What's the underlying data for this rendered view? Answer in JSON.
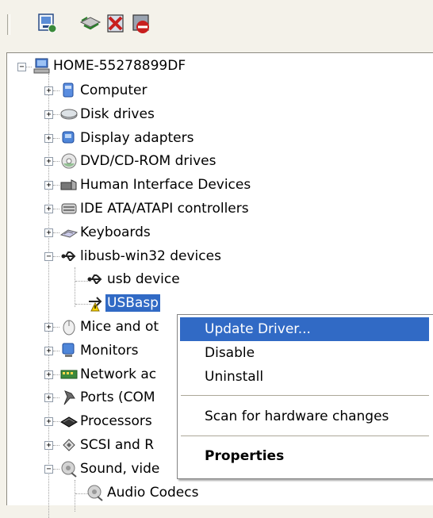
{
  "toolbar": {
    "buttons": [
      {
        "icon": "computer-properties-icon"
      },
      {
        "icon": "scan-hardware-icon"
      },
      {
        "icon": "uninstall-icon"
      },
      {
        "icon": "disable-icon"
      }
    ]
  },
  "tree": {
    "root": "HOME-55278899DF",
    "items": [
      {
        "label": "Computer",
        "icon": "computer-icon",
        "expanded": false
      },
      {
        "label": "Disk drives",
        "icon": "disk-drive-icon",
        "expanded": false
      },
      {
        "label": "Display adapters",
        "icon": "display-adapter-icon",
        "expanded": false
      },
      {
        "label": "DVD/CD-ROM drives",
        "icon": "dvd-drive-icon",
        "expanded": false
      },
      {
        "label": "Human Interface Devices",
        "icon": "hid-icon",
        "expanded": false
      },
      {
        "label": "IDE ATA/ATAPI controllers",
        "icon": "ide-controller-icon",
        "expanded": false
      },
      {
        "label": "Keyboards",
        "icon": "keyboard-icon",
        "expanded": false
      },
      {
        "label": "libusb-win32 devices",
        "icon": "usb-icon",
        "expanded": true,
        "children": [
          {
            "label": "usb device",
            "icon": "usb-icon"
          },
          {
            "label": "USBasp",
            "icon": "usb-warning-icon",
            "selected": true
          }
        ]
      },
      {
        "label": "Mice and ot",
        "icon": "mouse-icon",
        "expanded": false
      },
      {
        "label": "Monitors",
        "icon": "monitor-icon",
        "expanded": false
      },
      {
        "label": "Network ac",
        "icon": "network-adapter-icon",
        "expanded": false
      },
      {
        "label": "Ports (COM",
        "icon": "port-icon",
        "expanded": false
      },
      {
        "label": "Processors",
        "icon": "processor-icon",
        "expanded": false
      },
      {
        "label": "SCSI and R",
        "icon": "scsi-icon",
        "expanded": false
      },
      {
        "label": "Sound, vide",
        "icon": "sound-icon",
        "expanded": true,
        "children": [
          {
            "label": "Audio Codecs",
            "icon": "sound-icon"
          }
        ]
      }
    ]
  },
  "context_menu": {
    "update_driver": "Update Driver...",
    "disable": "Disable",
    "uninstall": "Uninstall",
    "scan": "Scan for hardware changes",
    "properties": "Properties"
  },
  "colors": {
    "selection": "#316ac5",
    "window_bg": "#f4f2ea"
  }
}
